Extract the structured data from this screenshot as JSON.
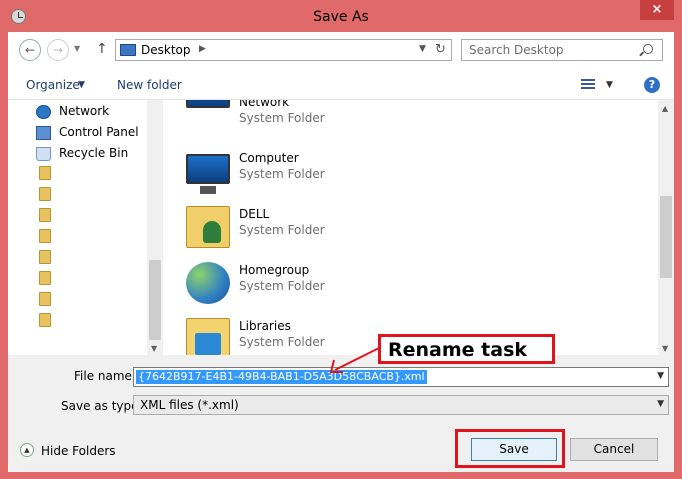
{
  "window": {
    "title": "Save As",
    "close_glyph": "×"
  },
  "navigation": {
    "back_icon": "back-arrow-icon",
    "forward_icon": "forward-arrow-icon",
    "up_icon": "up-arrow-icon",
    "address_location": "Desktop",
    "search_placeholder": "Search Desktop"
  },
  "toolbar": {
    "organize_label": "Organize",
    "new_folder_label": "New folder"
  },
  "nav_pane": {
    "items": [
      {
        "label": "Network",
        "icon": "network-icon"
      },
      {
        "label": "Control Panel",
        "icon": "control-panel-icon"
      },
      {
        "label": "Recycle Bin",
        "icon": "recycle-bin-icon"
      }
    ]
  },
  "file_list": {
    "items": [
      {
        "name": "Network",
        "type": "System Folder",
        "icon": "network-icon"
      },
      {
        "name": "Computer",
        "type": "System Folder",
        "icon": "computer-icon"
      },
      {
        "name": "DELL",
        "type": "System Folder",
        "icon": "user-folder-icon"
      },
      {
        "name": "Homegroup",
        "type": "System Folder",
        "icon": "homegroup-icon"
      },
      {
        "name": "Libraries",
        "type": "System Folder",
        "icon": "libraries-icon"
      }
    ]
  },
  "form": {
    "file_name_label": "File name:",
    "file_name_value": "{7642B917-E4B1-49B4-BAB1-D5A3D58CBACB}.xml",
    "save_type_label": "Save as type:",
    "save_type_value": "XML files (*.xml)"
  },
  "footer": {
    "hide_folders_label": "Hide Folders",
    "save_label": "Save",
    "cancel_label": "Cancel"
  },
  "annotation": {
    "callout_text": "Rename task",
    "highlight_color": "#e0141c"
  }
}
